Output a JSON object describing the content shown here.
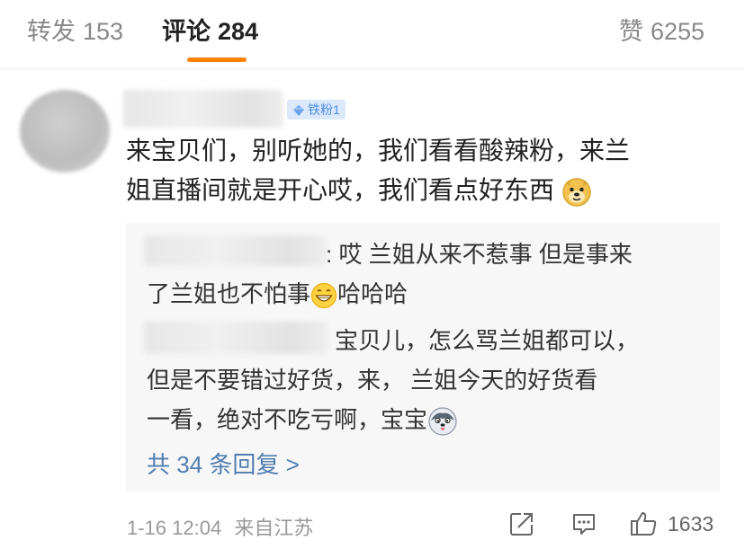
{
  "tabs": [
    {
      "label": "转发",
      "count": "153"
    },
    {
      "label": "评论",
      "count": "284"
    },
    {
      "label": "赞",
      "count": "6255"
    }
  ],
  "comment": {
    "badge": "铁粉1",
    "lines": [
      "来宝贝们，别听她的，我们看看酸辣粉，来兰",
      "姐直播间就是开心哎，我们看点好东西"
    ],
    "replies": [
      {
        "line1": ": 哎 兰姐从来不惹事 但是事来",
        "line2": "了兰姐也不怕事",
        "line2_tail": "哈哈哈"
      },
      {
        "line1": "宝贝儿，怎么骂兰姐都可以，",
        "line2": "但是不要错过好货，来， 兰姐今天的好货看",
        "line3": "一看，绝对不吃亏啊，宝宝"
      }
    ],
    "more_replies": "共 34 条回复 >",
    "timestamp": "1-16 12:04",
    "location": "来自江苏",
    "likes": "1633"
  },
  "icons": {
    "repost": "repost-icon",
    "reply": "comment-icon",
    "like": "thumbs-up-icon"
  },
  "colors": {
    "accent": "#ff8200",
    "link": "#507daf",
    "badge_bg": "#dbe9fb",
    "badge_text": "#4d8ce6"
  }
}
